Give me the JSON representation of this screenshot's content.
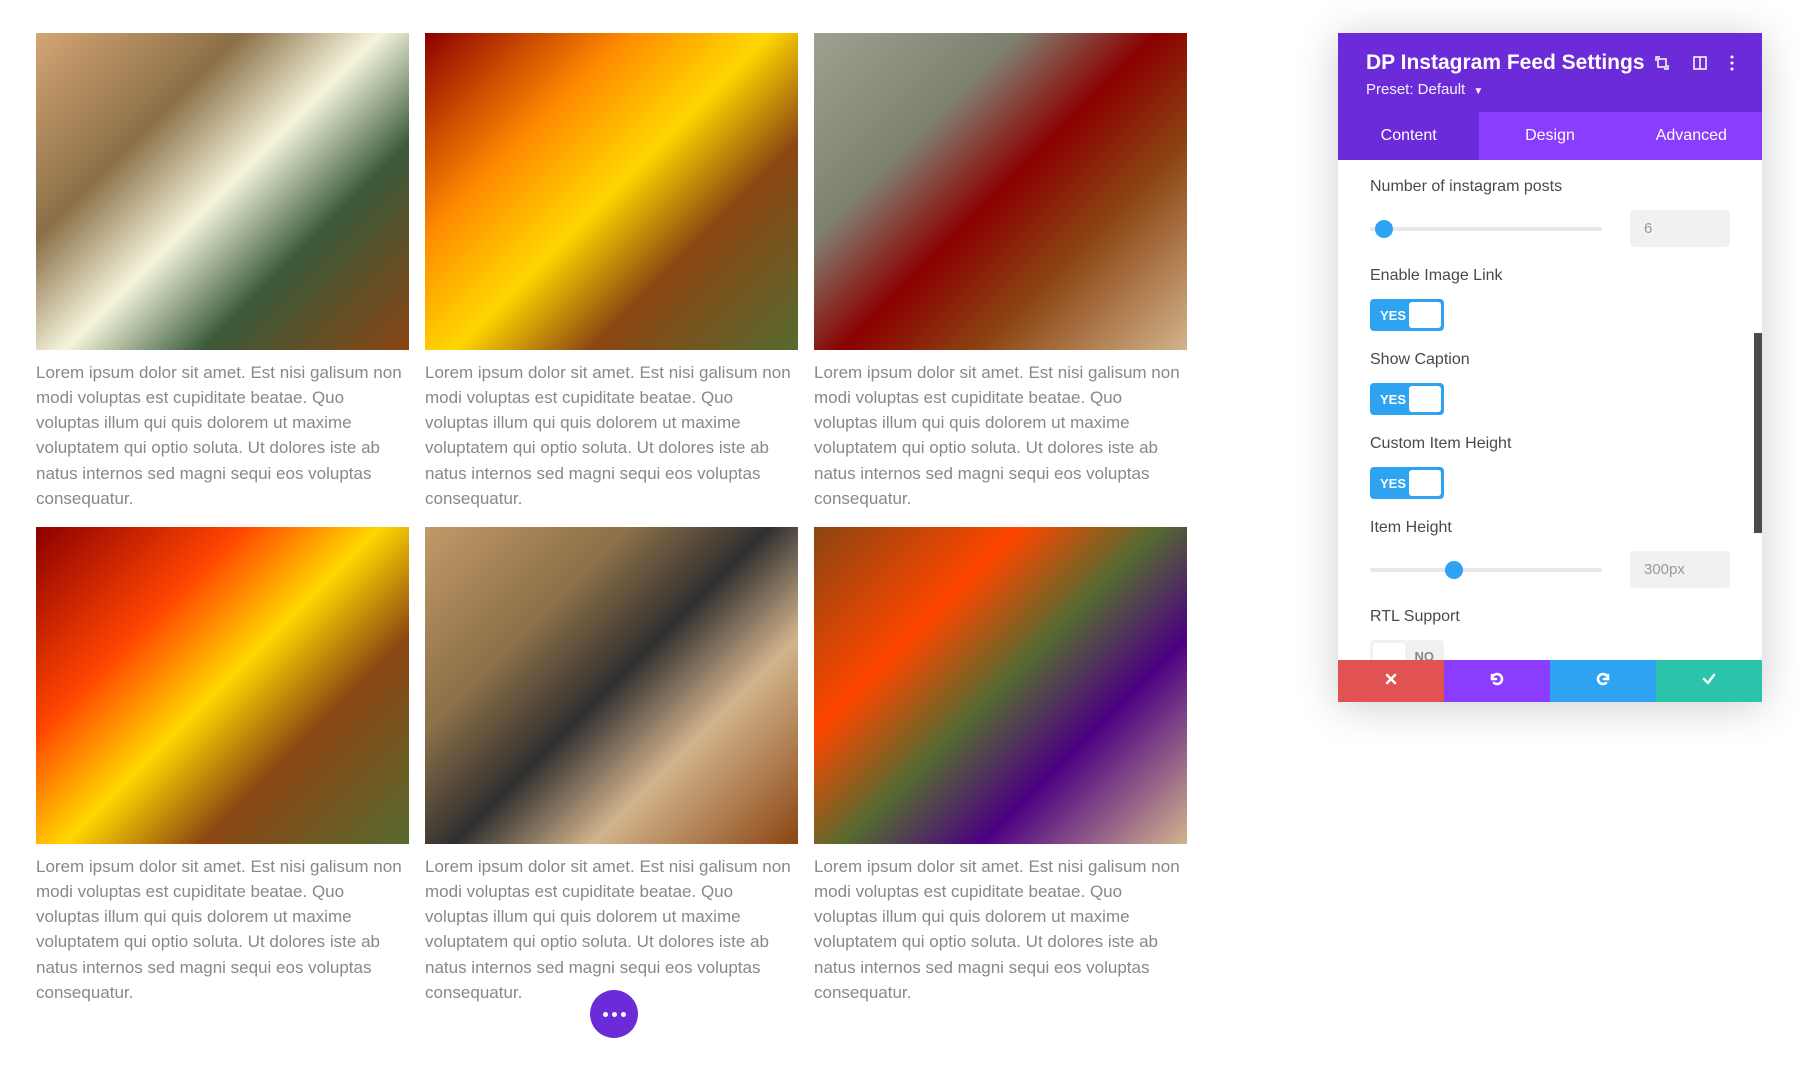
{
  "feed": {
    "caption": "Lorem ipsum dolor sit amet. Est nisi galisum non modi voluptas est cupiditate beatae. Quo voluptas illum qui quis dolorem ut maxime voluptatem qui optio soluta. Ut dolores iste ab natus internos sed magni sequi eos voluptas consequatur."
  },
  "panel": {
    "title": "DP Instagram Feed Settings",
    "preset_label": "Preset: Default",
    "tabs": {
      "content": "Content",
      "design": "Design",
      "advanced": "Advanced"
    },
    "controls": {
      "num_posts_label": "Number of instagram posts",
      "num_posts_value": "6",
      "num_posts_pct": 6,
      "enable_image_link_label": "Enable Image Link",
      "enable_image_link_value": "YES",
      "show_caption_label": "Show Caption",
      "show_caption_value": "YES",
      "custom_item_height_label": "Custom Item Height",
      "custom_item_height_value": "YES",
      "item_height_label": "Item Height",
      "item_height_value": "300px",
      "item_height_pct": 36,
      "rtl_support_label": "RTL Support",
      "rtl_support_value": "NO"
    }
  }
}
